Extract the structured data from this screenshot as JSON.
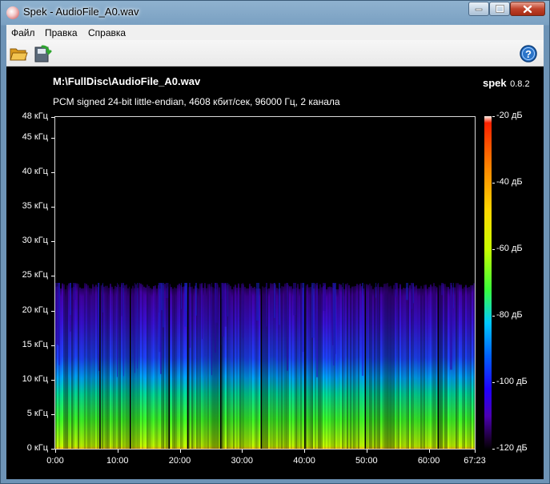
{
  "window": {
    "title": "Spek - AudioFile_A0.wav",
    "controls": {
      "minimize": "minimize",
      "maximize": "maximize",
      "close": "close"
    }
  },
  "menu": [
    {
      "label": "Файл"
    },
    {
      "label": "Правка"
    },
    {
      "label": "Справка"
    }
  ],
  "toolbar": {
    "open_icon": "folder-open-icon",
    "save_icon": "save-spectrogram-icon",
    "help_icon": "help-icon"
  },
  "spectrogram": {
    "file_path": "M:\\FullDisc\\AudioFile_A0.wav",
    "app_name": "spek",
    "app_version": "0.8.2",
    "file_info": "PCM signed 24-bit little-endian, 4608 кбит/сек, 96000 Гц, 2 канала",
    "frequency_labels": [
      "48 кГц",
      "45 кГц",
      "40 кГц",
      "35 кГц",
      "30 кГц",
      "25 кГц",
      "20 кГц",
      "15 кГц",
      "10 кГц",
      "5 кГц",
      "0 кГц"
    ],
    "frequency_values_khz": [
      48,
      45,
      40,
      35,
      30,
      25,
      20,
      15,
      10,
      5,
      0
    ],
    "time_labels": [
      "0:00",
      "10:00",
      "20:00",
      "30:00",
      "40:00",
      "50:00",
      "60:00",
      "67:23"
    ],
    "time_values_min": [
      0,
      10,
      20,
      30,
      40,
      50,
      60,
      67.383
    ],
    "total_minutes": 67.383,
    "db_labels": [
      "-20 дБ",
      "-40 дБ",
      "-60 дБ",
      "-80 дБ",
      "-100 дБ",
      "-120 дБ"
    ],
    "db_values": [
      -20,
      -40,
      -60,
      -80,
      -100,
      -120
    ],
    "db_range": [
      -120,
      -20
    ],
    "content_cutoff_khz": 24,
    "track_breaks_min": [
      7.1,
      12.0,
      18.2,
      21.2,
      26.5,
      33.0,
      40.0,
      49.7,
      61.4
    ]
  }
}
